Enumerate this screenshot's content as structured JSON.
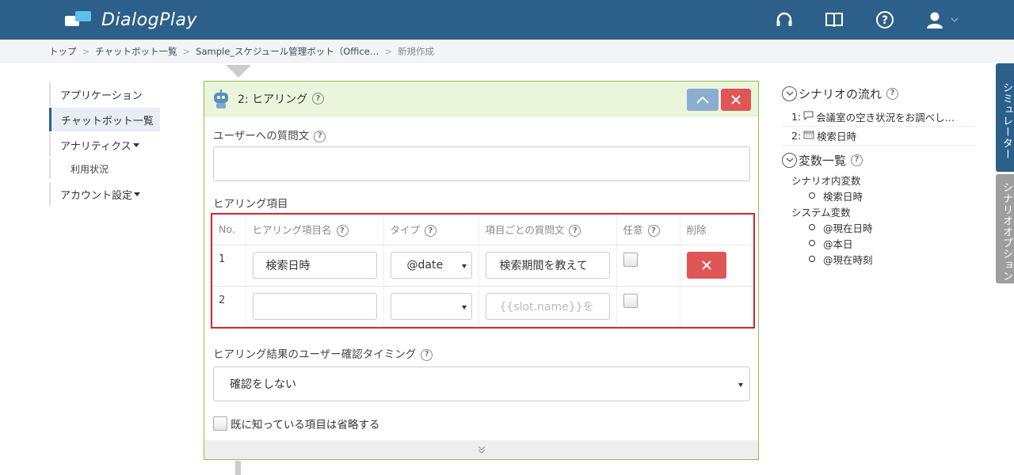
{
  "header": {
    "app_name": "DialogPlay",
    "icons": [
      "headset-icon",
      "book-icon",
      "help-icon",
      "user-icon"
    ]
  },
  "breadcrumb": [
    "トップ",
    "チャットボット一覧",
    "Sample_スケジュール管理ボット（Office…",
    "新規作成"
  ],
  "leftnav": {
    "application": "アプリケーション",
    "chatbot_list": "チャットボット一覧",
    "analytics": "アナリティクス",
    "usage": "利用状況",
    "account": "アカウント設定"
  },
  "panel": {
    "title": "2: ヒアリング",
    "question_label": "ユーザーへの質問文",
    "question_value": "",
    "items_label": "ヒアリング項目",
    "table": {
      "headers": [
        "No.",
        "ヒアリング項目名",
        "タイプ",
        "項目ごとの質問文",
        "任意",
        "削除"
      ],
      "rows": [
        {
          "no": "1",
          "name": "検索日時",
          "type": "@date",
          "question": "検索期間を教えて"
        },
        {
          "no": "2",
          "name": "",
          "type": "",
          "question_placeholder": "{{slot.name}}を"
        }
      ]
    },
    "confirm_label": "ヒアリング結果のユーザー確認タイミング",
    "confirm_value": "確認をしない",
    "skip_label": "既に知っている項目は省略する"
  },
  "right": {
    "flow_title": "シナリオの流れ",
    "flow_items": [
      "1: ",
      "会議室の空き状況をお調べし…",
      "2: ",
      "検索日時"
    ],
    "vars_title": "変数一覧",
    "scenario_vars_label": "シナリオ内変数",
    "scenario_vars": [
      "検索日時"
    ],
    "system_vars_label": "システム変数",
    "system_vars": [
      "@現在日時",
      "@本日",
      "@現在時刻"
    ]
  },
  "sidetabs": {
    "simulator": "シミュレーター",
    "scenario_option": "シナリオオプション"
  },
  "colors": {
    "header_bg": "#2d5f8b",
    "accent_green": "#8bc34a",
    "danger": "#e05555",
    "highlight_red": "#d9232d"
  }
}
